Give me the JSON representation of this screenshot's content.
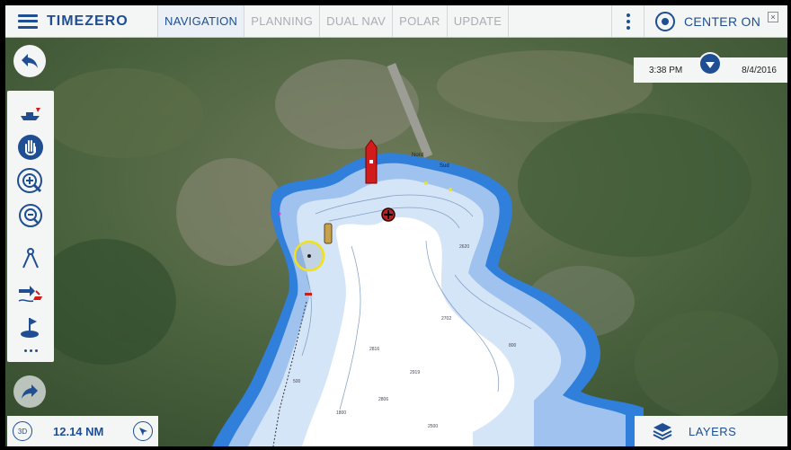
{
  "app": {
    "brand": "TIMEZERO"
  },
  "tabs": [
    {
      "label": "NAVIGATION",
      "active": true
    },
    {
      "label": "PLANNING",
      "active": false
    },
    {
      "label": "DUAL NAV",
      "active": false
    },
    {
      "label": "POLAR",
      "active": false
    },
    {
      "label": "UPDATE",
      "active": false
    }
  ],
  "header": {
    "center_on": "CENTER ON"
  },
  "time_panel": {
    "time": "3:38 PM",
    "date": "8/4/2016"
  },
  "map": {
    "place_labels": [
      "Nord",
      "Sud"
    ],
    "sounding_labels": [
      "2816",
      "2919",
      "2806",
      "2702",
      "2620",
      "1800",
      "2500",
      "500",
      "800"
    ]
  },
  "bottom": {
    "mode_label": "3D",
    "range": "12.14 NM"
  },
  "layers": {
    "label": "LAYERS"
  },
  "colors": {
    "accent": "#1f4e93",
    "panel": "#f4f5f5",
    "deep_water": "#ffffff",
    "shallow_water": "#3a86dd"
  }
}
